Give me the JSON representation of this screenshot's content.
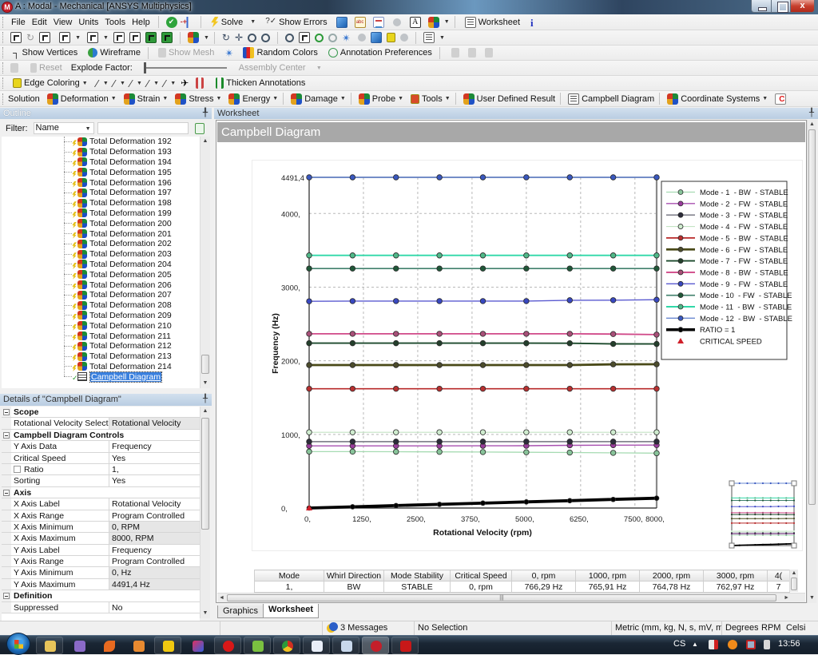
{
  "window": {
    "title": "A : Modal - Mechanical [ANSYS Multiphysics]",
    "controls": [
      "minimize",
      "restore",
      "close"
    ]
  },
  "menu": [
    "File",
    "Edit",
    "View",
    "Units",
    "Tools",
    "Help"
  ],
  "toolbar_standard": {
    "solve": "Solve",
    "show_errors": "Show Errors",
    "worksheet": "Worksheet"
  },
  "toolbar_graphics_options": {
    "show_vertices": "Show Vertices",
    "wireframe": "Wireframe",
    "show_mesh": "Show Mesh",
    "random_colors": "Random Colors",
    "annotation_preferences": "Annotation Preferences"
  },
  "toolbar_explode": {
    "reset": "Reset",
    "explode_factor_label": "Explode Factor:",
    "explode_factor_value": 0,
    "assembly_center": "Assembly Center"
  },
  "toolbar_edge": {
    "edge_coloring": "Edge Coloring",
    "thicken_annotations": "Thicken Annotations"
  },
  "toolbar_context": {
    "solution": "Solution",
    "deformation": "Deformation",
    "strain": "Strain",
    "stress": "Stress",
    "energy": "Energy",
    "damage": "Damage",
    "probe": "Probe",
    "tools": "Tools",
    "user_defined_result": "User Defined Result",
    "campbell_diagram": "Campbell Diagram",
    "coordinate_systems": "Coordinate Systems"
  },
  "outline": {
    "title": "Outline",
    "filter_label": "Filter:",
    "filter_by": "Name",
    "filter_text": "",
    "items": [
      "Total Deformation 192",
      "Total Deformation 193",
      "Total Deformation 194",
      "Total Deformation 195",
      "Total Deformation 196",
      "Total Deformation 197",
      "Total Deformation 198",
      "Total Deformation 199",
      "Total Deformation 200",
      "Total Deformation 201",
      "Total Deformation 202",
      "Total Deformation 203",
      "Total Deformation 204",
      "Total Deformation 205",
      "Total Deformation 206",
      "Total Deformation 207",
      "Total Deformation 208",
      "Total Deformation 209",
      "Total Deformation 210",
      "Total Deformation 211",
      "Total Deformation 212",
      "Total Deformation 213",
      "Total Deformation 214"
    ],
    "selected_item": "Campbell Diagram"
  },
  "details": {
    "title": "Details of \"Campbell Diagram\"",
    "sections": [
      {
        "name": "Scope",
        "rows": [
          {
            "label": "Rotational Velocity Selection",
            "value": "Rotational Velocity",
            "read_only": true
          }
        ]
      },
      {
        "name": "Campbell Diagram Controls",
        "rows": [
          {
            "label": "Y Axis Data",
            "value": "Frequency"
          },
          {
            "label": "Critical Speed",
            "value": "Yes"
          },
          {
            "label": "Ratio",
            "value": "1,",
            "checked": false
          },
          {
            "label": "Sorting",
            "value": "Yes"
          }
        ]
      },
      {
        "name": "Axis",
        "rows": [
          {
            "label": "X Axis Label",
            "value": "Rotational Velocity"
          },
          {
            "label": "X Axis Range",
            "value": "Program Controlled"
          },
          {
            "label": "X Axis Minimum",
            "value": "0, RPM",
            "read_only": true
          },
          {
            "label": "X Axis Maximum",
            "value": "8000, RPM",
            "read_only": true
          },
          {
            "label": "Y Axis Label",
            "value": "Frequency"
          },
          {
            "label": "Y Axis Range",
            "value": "Program Controlled"
          },
          {
            "label": "Y Axis Minimum",
            "value": "0, Hz",
            "read_only": true
          },
          {
            "label": "Y Axis Maximum",
            "value": "4491,4 Hz",
            "read_only": true
          }
        ]
      },
      {
        "name": "Definition",
        "rows": [
          {
            "label": "Suppressed",
            "value": "No"
          }
        ]
      }
    ]
  },
  "worksheet": {
    "header": "Worksheet",
    "title": "Campbell Diagram"
  },
  "chart_data": {
    "type": "line",
    "title": "Campbell Diagram",
    "xlabel": "Rotational Velocity (rpm)",
    "ylabel": "Frequency (Hz)",
    "xlim": [
      0,
      8000
    ],
    "ylim": [
      0,
      4491.4
    ],
    "x_ticks": [
      0,
      1250,
      2500,
      3750,
      5000,
      6250,
      7500,
      8000
    ],
    "x_tick_labels": [
      "0,",
      "1250,",
      "2500,",
      "3750,",
      "5000,",
      "6250,",
      "7500,",
      "8000,"
    ],
    "y_ticks": [
      0,
      1000,
      2000,
      3000,
      4000,
      4491.4
    ],
    "y_tick_labels": [
      "0,",
      "1000,",
      "2000,",
      "3000,",
      "4000,",
      "4491,4"
    ],
    "grid": true,
    "legend_position": "right",
    "x": [
      0,
      1000,
      2000,
      3000,
      4000,
      5000,
      6000,
      7000,
      8000
    ],
    "series": [
      {
        "name": "Mode - 1  - BW  - STABLE",
        "line_color": "#a6dbb2",
        "marker_color": "#88c49a",
        "values": [
          766.29,
          765.91,
          764.78,
          762.97,
          760.5,
          757.4,
          753.8,
          749.6,
          745.0
        ]
      },
      {
        "name": "Mode - 2  - FW  - STABLE",
        "line_color": "#a850b0",
        "marker_color": "#9a3c9c",
        "values": [
          844,
          844,
          844,
          844,
          845,
          846,
          852,
          854,
          855
        ]
      },
      {
        "name": "Mode - 3  - FW  - STABLE",
        "line_color": "#85858f",
        "marker_color": "#2c2c3a",
        "values": [
          902,
          902,
          902,
          902,
          902,
          902,
          902,
          902,
          902
        ]
      },
      {
        "name": "Mode - 4  - FW  - STABLE",
        "line_color": "#c4e4c4",
        "marker_color": "#cfeccf",
        "values": [
          1029,
          1029,
          1029,
          1029,
          1029,
          1029,
          1029,
          1029,
          1029
        ]
      },
      {
        "name": "Mode - 5  - BW  - STABLE",
        "line_color": "#b82828",
        "marker_color": "#b83030",
        "values": [
          1620,
          1620,
          1620,
          1620,
          1620,
          1620,
          1620,
          1620,
          1620
        ]
      },
      {
        "name": "Mode - 6  - FW  - STABLE",
        "line_color": "#4a4a18",
        "marker_color": "#4c4c2c",
        "values": [
          1942,
          1942,
          1942,
          1942,
          1942,
          1942,
          1942,
          1952,
          1953
        ]
      },
      {
        "name": "Mode - 7  - FW  - STABLE",
        "line_color": "#1c4a2c",
        "marker_color": "#24402c",
        "values": [
          2239,
          2239,
          2239,
          2239,
          2239,
          2239,
          2238,
          2229,
          2228
        ]
      },
      {
        "name": "Mode - 8  - BW  - STABLE",
        "line_color": "#d04888",
        "marker_color": "#a85078",
        "values": [
          2366,
          2366,
          2366,
          2366,
          2366,
          2366,
          2366,
          2363,
          2355
        ]
      },
      {
        "name": "Mode - 9  - FW  - STABLE",
        "line_color": "#5a5ad0",
        "marker_color": "#3848c0",
        "values": [
          2808,
          2811,
          2811,
          2811,
          2811,
          2811,
          2822,
          2823,
          2829
        ]
      },
      {
        "name": "Mode - 10  - FW  - STABLE",
        "line_color": "#40806c",
        "marker_color": "#205838",
        "values": [
          3253,
          3253,
          3253,
          3253,
          3253,
          3253,
          3253,
          3253,
          3253
        ]
      },
      {
        "name": "Mode - 11  - BW  - STABLE",
        "line_color": "#30d8a8",
        "marker_color": "#50b888",
        "values": [
          3431,
          3431,
          3431,
          3431,
          3431,
          3431,
          3431,
          3431,
          3431
        ]
      },
      {
        "name": "Mode - 12  - BW  - STABLE",
        "line_color": "#6a88d0",
        "marker_color": "#3a58c0",
        "values": [
          4491.4,
          4491.4,
          4491.4,
          4491.4,
          4491.4,
          4491.4,
          4491.4,
          4491.4,
          4491.4
        ]
      },
      {
        "name": "RATIO = 1",
        "line_color": "#000000",
        "marker_color": "#000000",
        "values": [
          0,
          16.67,
          33.33,
          50,
          66.67,
          83.33,
          100,
          116.67,
          133.33
        ]
      }
    ],
    "critical_speed": {
      "name": "CRITICAL SPEED",
      "color": "#d0202a",
      "points": [
        [
          0,
          0
        ]
      ]
    }
  },
  "table": {
    "headers": [
      "Mode",
      "Whirl Direction",
      "Mode Stability",
      "Critical Speed",
      "0, rpm",
      "1000, rpm",
      "2000, rpm",
      "3000, rpm",
      "4("
    ],
    "rows": [
      [
        "1,",
        "BW",
        "STABLE",
        "0, rpm",
        "766,29 Hz",
        "765,91 Hz",
        "764,78 Hz",
        "762,97 Hz",
        "7"
      ]
    ]
  },
  "tabs": {
    "items": [
      "Graphics",
      "Worksheet"
    ],
    "active": "Worksheet"
  },
  "status": {
    "messages": "3 Messages",
    "selection": "No Selection",
    "unit_system": "Metric (mm, kg, N, s, mV, mA)",
    "angle_unit": "Degrees",
    "rotational_velocity_unit": "RPM",
    "temperature_unit": "Celsi"
  },
  "taskbar": {
    "apps": [
      "windows-explorer",
      "visual-studio",
      "matlab",
      "inventor",
      "autodesk",
      "paint",
      "opera",
      "messenger",
      "chrome",
      "document-viewer",
      "calculator",
      "ansys-mechanical",
      "acrobat-reader"
    ],
    "active_app": "ansys-mechanical",
    "language": "CS",
    "clock": "13:56"
  }
}
